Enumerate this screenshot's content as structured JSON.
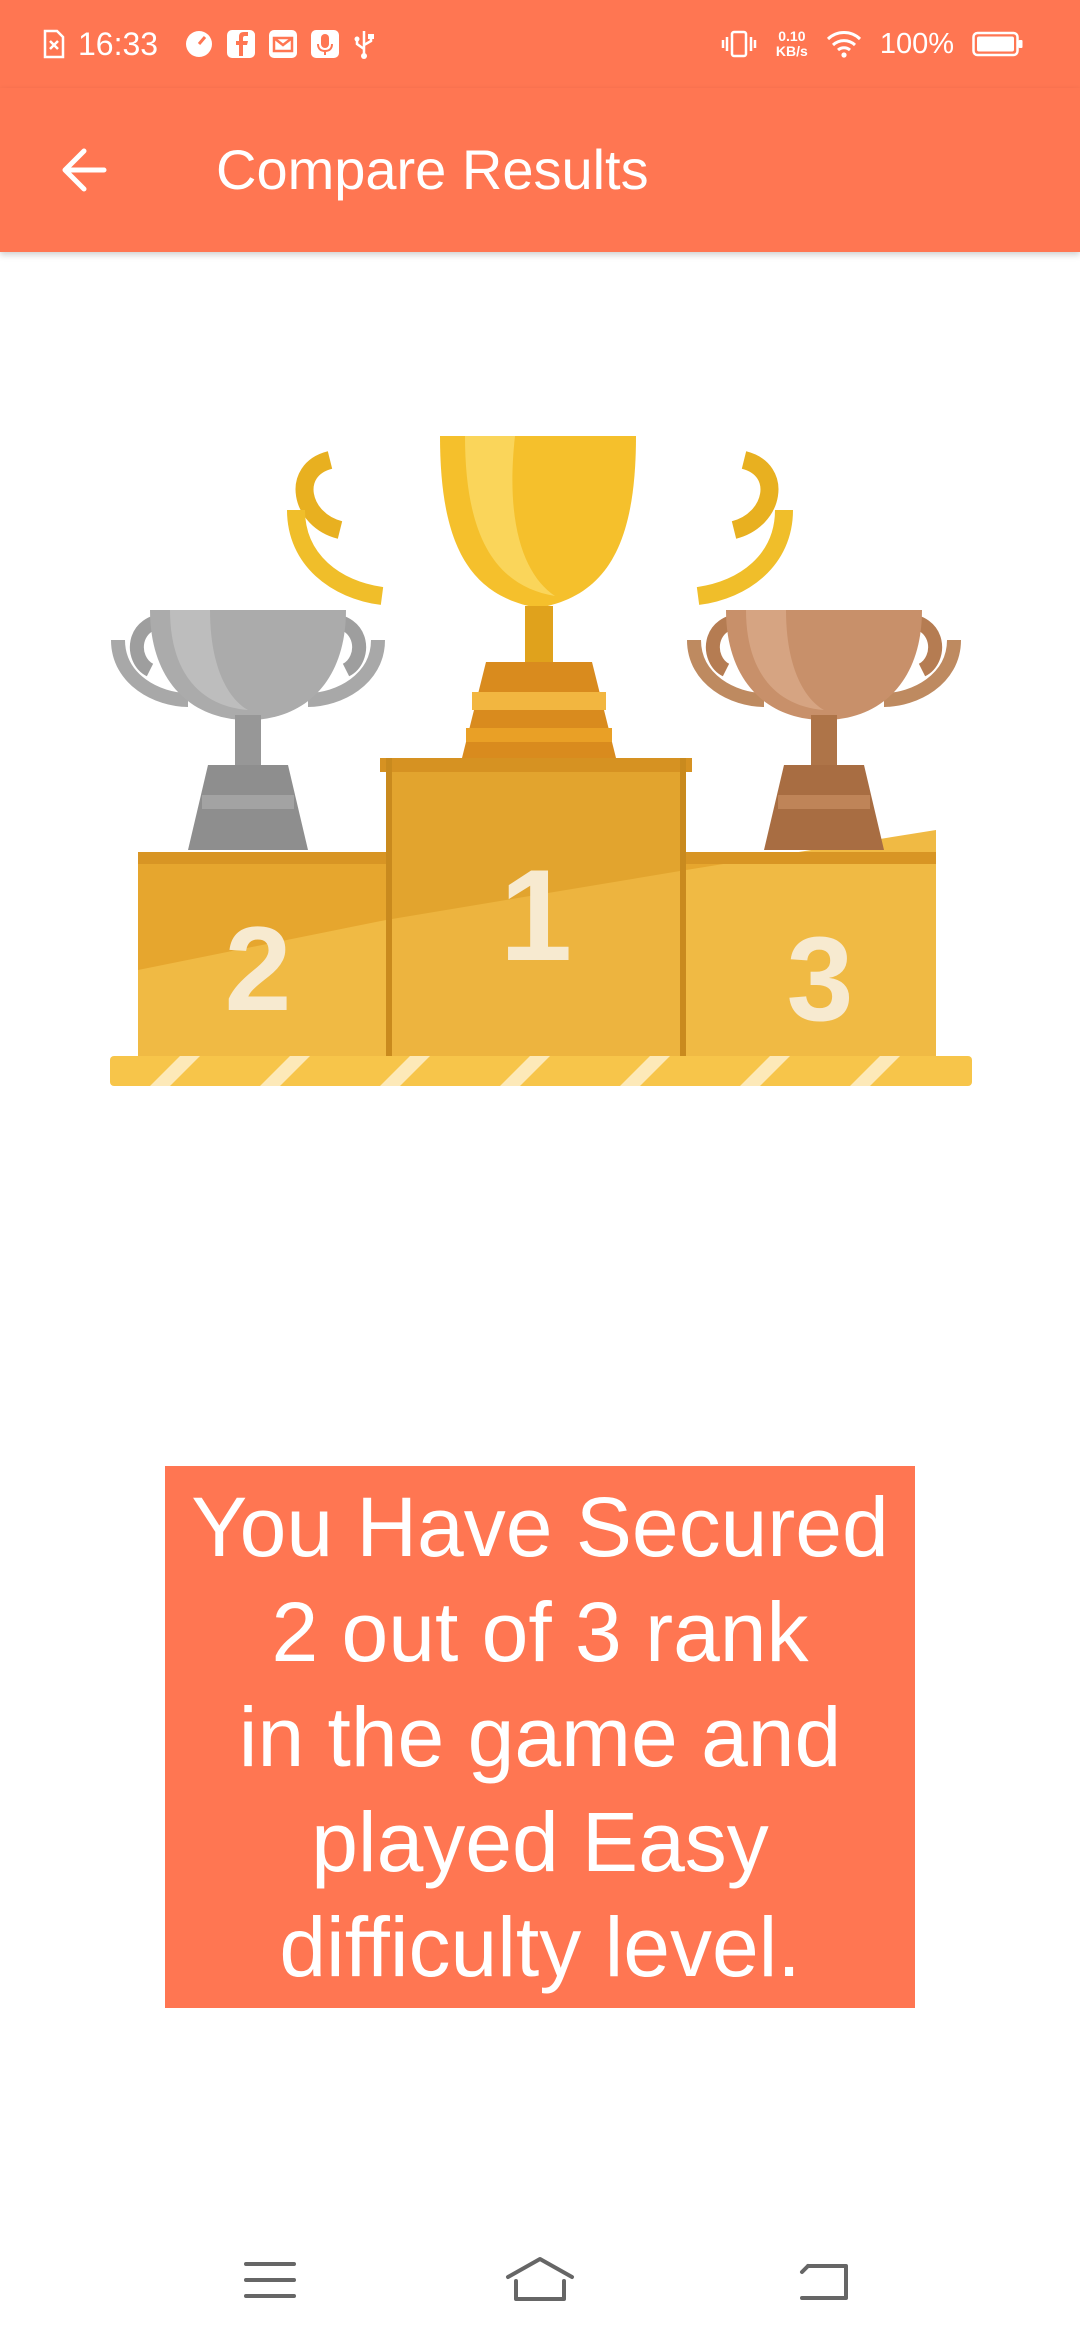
{
  "status_bar": {
    "time": "16:33",
    "net_speed_value": "0.10",
    "net_speed_unit": "KB/s",
    "battery_percent": "100%",
    "icons": [
      "sim-error-icon",
      "speedometer-icon",
      "facebook-icon",
      "mail-icon",
      "mic-icon",
      "usb-icon",
      "vibrate-icon",
      "wifi-icon",
      "battery-icon"
    ]
  },
  "app_bar": {
    "title": "Compare Results",
    "back_icon": "arrow-left-icon"
  },
  "illustration": {
    "name": "trophy-podium",
    "ranks": [
      "2",
      "1",
      "3"
    ]
  },
  "result": {
    "message": "You Have Secured\n2 out of 3 rank\nin the game and\nplayed Easy\ndifficulty level."
  },
  "nav_bar": {
    "icons": [
      "menu-icon",
      "home-icon",
      "back-nav-icon"
    ]
  },
  "colors": {
    "accent": "#FF7652",
    "gold": "#F5C02C",
    "silver": "#A9A9A9",
    "bronze": "#C8906A"
  }
}
